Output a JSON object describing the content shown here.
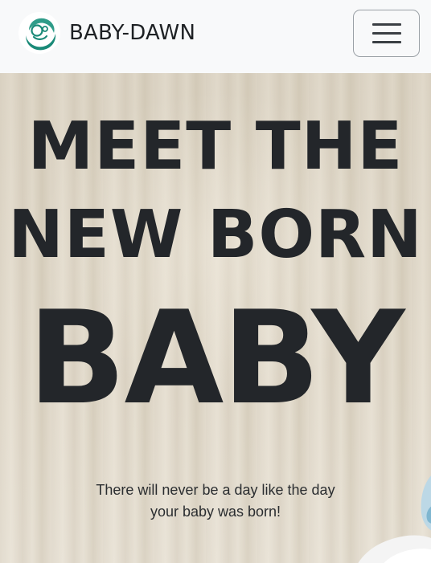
{
  "navbar": {
    "brand_name": "BABY-DAWN",
    "logo_icon": "mother-baby-logo-icon",
    "menu_icon": "hamburger-menu-icon",
    "brand_color": "#1a8a78"
  },
  "hero": {
    "line1": "MEET THE",
    "line2": "NEW BORN",
    "line3": "BABY",
    "tagline_line1": "There will never be a day like the day",
    "tagline_line2": "your baby was born!"
  }
}
